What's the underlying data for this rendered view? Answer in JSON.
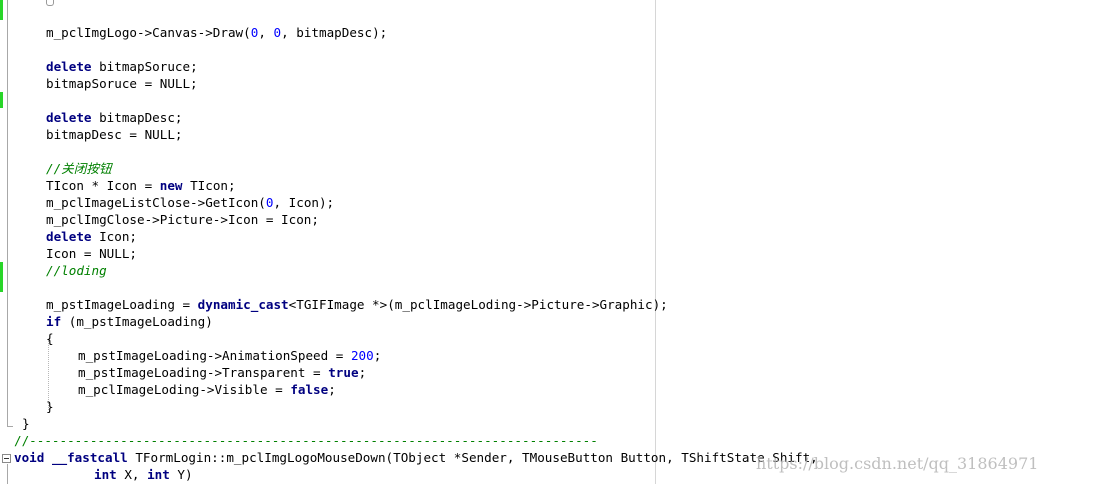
{
  "code_lines": [
    "m_pclImgLogo->Canvas->Draw(0, 0, bitmapDesc);",
    "delete bitmapSoruce;",
    "bitmapSoruce = NULL;",
    "delete bitmapDesc;",
    "bitmapDesc = NULL;",
    "//关闭按钮",
    "TIcon * Icon = new TIcon;",
    "m_pclImageListClose->GetIcon(0, Icon);",
    "m_pclImgClose->Picture->Icon = Icon;",
    "delete Icon;",
    "Icon = NULL;",
    "//loding",
    "m_pstImageLoading = dynamic_cast<TGIFImage *>(m_pclImageLoding->Picture->Graphic);",
    "if (m_pstImageLoading)",
    "{",
    "m_pstImageLoading->AnimationSpeed = 200;",
    "m_pstImageLoading->Transparent = true;",
    "m_pclImageLoding->Visible = false;",
    "}",
    "}",
    "//---------------------------------------------------------------------------",
    "void __fastcall TFormLogin::m_pclImgLogoMouseDown(TObject *Sender, TMouseButton Button, TShiftState Shift,",
    "int X, int Y)"
  ],
  "watermark": "https://blog.csdn.net/qq_31864971",
  "colors": {
    "keyword": "#000080",
    "number": "#0000ff",
    "comment": "#008000",
    "change_bar": "#29d629"
  }
}
